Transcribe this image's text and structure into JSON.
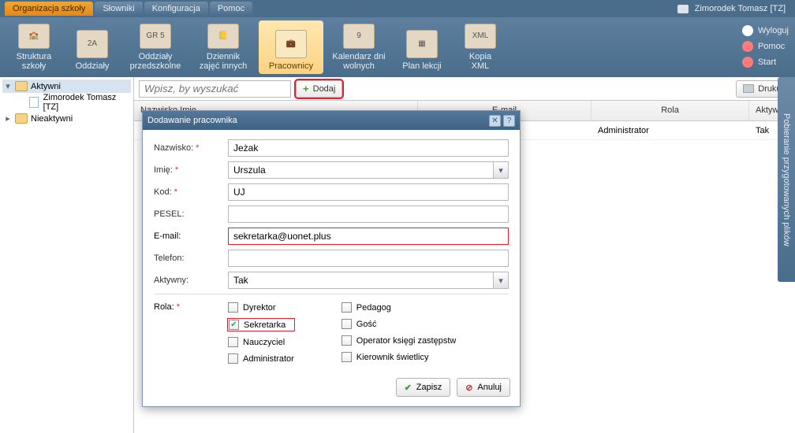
{
  "topbar": {
    "tabs": [
      "Organizacja szkoły",
      "Słowniki",
      "Konfiguracja",
      "Pomoc"
    ],
    "active_tab": 0,
    "user": "Zimorodek Tomasz [TZ]"
  },
  "ribbon": {
    "buttons": [
      {
        "label": "Struktura\nszkoły",
        "icon": "building"
      },
      {
        "label": "Oddziały",
        "icon": "2A"
      },
      {
        "label": "Oddziały\nprzedszkolne",
        "icon": "GR 5"
      },
      {
        "label": "Dziennik\nzajęć innych",
        "icon": "dziennik"
      },
      {
        "label": "Pracownicy",
        "icon": "briefcase",
        "active": true
      },
      {
        "label": "Kalendarz dni\nwolnych",
        "icon": "cal9"
      },
      {
        "label": "Plan lekcji",
        "icon": "grid"
      },
      {
        "label": "Kopia\nXML",
        "icon": "xml"
      }
    ],
    "links": [
      {
        "label": "Wyloguj",
        "icon": "lock"
      },
      {
        "label": "Pomoc",
        "icon": "help"
      },
      {
        "label": "Start",
        "icon": "home"
      }
    ]
  },
  "tree": {
    "aktywni": "Aktywni",
    "aktywni_item": "Zimorodek Tomasz [TZ]",
    "nieaktywni": "Nieaktywni"
  },
  "toolbar": {
    "search_placeholder": "Wpisz, by wyszukać",
    "dodaj": "Dodaj",
    "drukuj": "Drukuj"
  },
  "grid": {
    "cols": {
      "nazw": "Nazwisko Imię",
      "email": "E-mail",
      "rola": "Rola",
      "aktywny": "Aktywny"
    },
    "rows": [
      {
        "nazw": "",
        "email": "",
        "rola": "Administrator",
        "aktywny": "Tak"
      }
    ]
  },
  "sidetab": "Pobieranie przygotowanych plików",
  "modal": {
    "title": "Dodawanie pracownika",
    "fields": {
      "nazwisko": {
        "label": "Nazwisko:",
        "value": "Jeżak"
      },
      "imie": {
        "label": "Imię:",
        "value": "Urszula"
      },
      "kod": {
        "label": "Kod:",
        "value": "UJ"
      },
      "pesel": {
        "label": "PESEL:",
        "value": ""
      },
      "email": {
        "label": "E-mail:",
        "value": "sekretarka@uonet.plus"
      },
      "telefon": {
        "label": "Telefon:",
        "value": ""
      },
      "aktywny": {
        "label": "Aktywny:",
        "value": "Tak"
      }
    },
    "rola_label": "Rola:",
    "roles_left": [
      "Dyrektor",
      "Sekretarka",
      "Nauczyciel",
      "Administrator"
    ],
    "roles_right": [
      "Pedagog",
      "Gość",
      "Operator księgi zastępstw",
      "Kierownik świetlicy"
    ],
    "checked_role": "Sekretarka",
    "zapisz": "Zapisz",
    "anuluj": "Anuluj"
  }
}
